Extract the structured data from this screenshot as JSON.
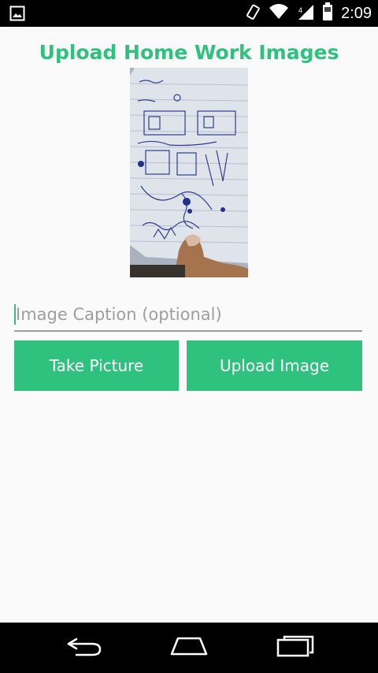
{
  "status_bar": {
    "time": "2:09",
    "left_icon": "image-notification-icon",
    "icons": [
      "rotation-icon",
      "wifi-icon",
      "signal-icon",
      "battery-icon"
    ]
  },
  "page": {
    "title": "Upload Home Work Images",
    "caption_placeholder": "Image Caption (optional)",
    "caption_value": "",
    "take_picture_label": "Take Picture",
    "upload_image_label": "Upload Image"
  },
  "colors": {
    "accent": "#2ec27e",
    "background": "#fafafa",
    "system_bar": "#000000"
  },
  "nav_bar": {
    "buttons": [
      "back-icon",
      "home-icon",
      "recents-icon"
    ]
  }
}
